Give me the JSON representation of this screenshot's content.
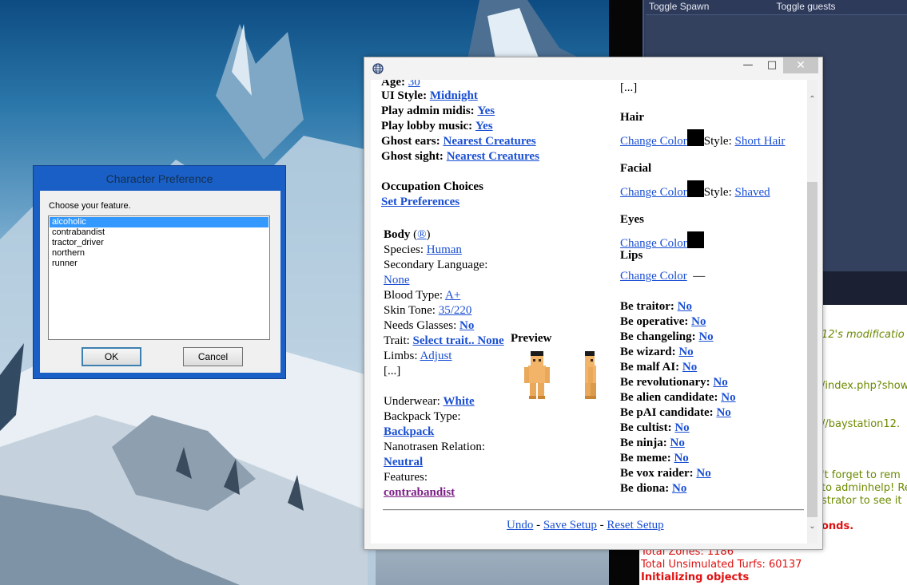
{
  "game_panel": {
    "toggle_spawn": "Toggle Spawn",
    "toggle_guests": "Toggle guests"
  },
  "chat": {
    "line1": "12's modificatio",
    "line2": "/index.php?show",
    "line3": "//baystation12.",
    "line4": "'t forget to rem",
    "line5": "to adminhelp! Re",
    "line6": "strator to see it",
    "line7": "onds.",
    "line8": "Total Zones: 1186",
    "line9": "Total Unsimulated Turfs: 60137",
    "line10": "Initializing objects"
  },
  "char_pref_dialog": {
    "title": "Character Preference",
    "prompt": "Choose your feature.",
    "options": [
      "alcoholic",
      "contrabandist",
      "tractor_driver",
      "northern",
      "runner"
    ],
    "selected": "alcoholic",
    "ok_label": "OK",
    "cancel_label": "Cancel"
  },
  "prefs_window": {
    "top_partial": {
      "label": "Age:",
      "value": "30"
    },
    "ui_style": {
      "label": "UI Style:",
      "value": "Midnight"
    },
    "admin_midis": {
      "label": "Play admin midis:",
      "value": "Yes"
    },
    "lobby_music": {
      "label": "Play lobby music:",
      "value": "Yes"
    },
    "ghost_ears": {
      "label": "Ghost ears:",
      "value": "Nearest Creatures"
    },
    "ghost_sight": {
      "label": "Ghost sight:",
      "value": "Nearest Creatures"
    },
    "occupation": {
      "heading": "Occupation Choices",
      "link": "Set Preferences"
    },
    "body": {
      "heading": "Body",
      "open_paren": "(",
      "random_link": "®",
      "close_paren": ")",
      "species_label": "Species:",
      "species": "Human",
      "secondary_lang_label": "Secondary Language:",
      "secondary_lang": "None",
      "blood_label": "Blood Type:",
      "blood": "A+",
      "skin_label": "Skin Tone:",
      "skin": "35/220",
      "glasses_label": "Needs Glasses:",
      "glasses": "No",
      "trait_label": "Trait:",
      "trait": "Select trait.. None",
      "limbs_label": "Limbs:",
      "limbs": "Adjust",
      "ellipsis": "[...]"
    },
    "preview_label": "Preview",
    "underwear_label": "Underwear:",
    "underwear": "White",
    "backpack_label": "Backpack Type:",
    "backpack": "Backpack",
    "relation_label": "Nanotrasen Relation:",
    "relation": "Neutral",
    "features_label": "Features:",
    "features": "contrabandist",
    "right_ellipsis": "[...]",
    "hair": {
      "heading": "Hair",
      "change": "Change Color",
      "style_label": "Style:",
      "style": "Short Hair"
    },
    "facial": {
      "heading": "Facial",
      "change": "Change Color",
      "style_label": "Style:",
      "style": "Shaved"
    },
    "eyes": {
      "heading": "Eyes",
      "change": "Change Color"
    },
    "lips": {
      "heading": "Lips",
      "change": "Change Color",
      "value": "—"
    },
    "roles": [
      {
        "label": "Be traitor:",
        "value": "No"
      },
      {
        "label": "Be operative:",
        "value": "No"
      },
      {
        "label": "Be changeling:",
        "value": "No"
      },
      {
        "label": "Be wizard:",
        "value": "No"
      },
      {
        "label": "Be malf AI:",
        "value": "No"
      },
      {
        "label": "Be revolutionary:",
        "value": "No"
      },
      {
        "label": "Be alien candidate:",
        "value": "No"
      },
      {
        "label": "Be pAI candidate:",
        "value": "No"
      },
      {
        "label": "Be cultist:",
        "value": "No"
      },
      {
        "label": "Be ninja:",
        "value": "No"
      },
      {
        "label": "Be meme:",
        "value": "No"
      },
      {
        "label": "Be vox raider:",
        "value": "No"
      },
      {
        "label": "Be diona:",
        "value": "No"
      }
    ],
    "footer": {
      "undo": "Undo",
      "sep1": "-",
      "save": "Save Setup",
      "sep2": "-",
      "reset": "Reset Setup"
    }
  },
  "colors": {
    "link": "#1a4fd3",
    "visited": "#7a1e86",
    "dialog_frame": "#1a5fc6",
    "list_selection": "#3399ff",
    "chat_red": "#e01010",
    "chat_olive": "#6c8a00"
  }
}
